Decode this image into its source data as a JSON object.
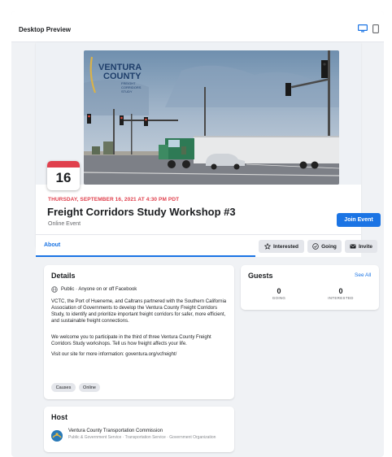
{
  "preview": {
    "title": "Desktop Preview",
    "device_icons": [
      "desktop-icon",
      "mobile-icon"
    ]
  },
  "cover": {
    "logo_line1": "VENTURA",
    "logo_line2": "COUNTY",
    "logo_sub1": "FREIGHT",
    "logo_sub2": "CORRIDORS",
    "logo_sub3": "STUDY"
  },
  "event": {
    "day": "16",
    "date_text": "THURSDAY, SEPTEMBER 16, 2021 AT 4:30 PM PDT",
    "title": "Freight Corridors Study Workshop #3",
    "subtitle": "Online Event",
    "join_label": "Join Event"
  },
  "tabs": {
    "about_label": "About",
    "interested_label": "Interested",
    "going_label": "Going",
    "invite_label": "Invite"
  },
  "details": {
    "title": "Details",
    "privacy": "Public · Anyone on or off Facebook",
    "paragraph1": "VCTC, the Port of Hueneme, and Caltrans partnered with the Southern California Association of Governments to develop the Ventura County Freight Corridors Study, to identify and prioritize important freight corridors for safer, more efficient, and sustainable freight connections.",
    "paragraph2": "We welcome you to participate in the third of three Ventura County Freight Corridors Study workshops. Tell us how freight affects your life.",
    "paragraph3": "Visit our site for more information: goventura.org/vcfreight/",
    "tags": [
      "Causes",
      "Online"
    ]
  },
  "guests": {
    "title": "Guests",
    "see_all": "See All",
    "going_count": "0",
    "going_label": "GOING",
    "interested_count": "0",
    "interested_label": "INTERESTED"
  },
  "host": {
    "title": "Host",
    "name": "Ventura County Transportation Commission",
    "categories": "Public & Government Service · Transportation Service · Government Organization"
  },
  "colors": {
    "accent": "#1b74e4",
    "date_red": "#e0404d",
    "background": "#f0f2f5"
  }
}
